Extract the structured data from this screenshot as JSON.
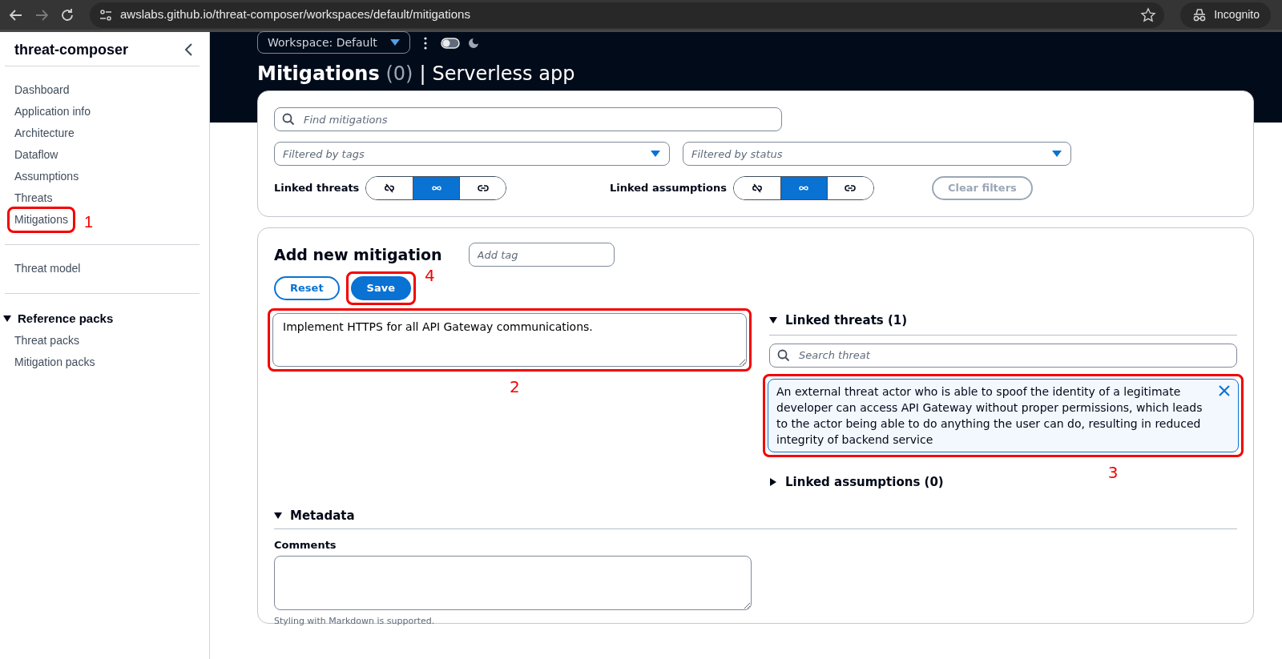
{
  "browser": {
    "url": "awslabs.github.io/threat-composer/workspaces/default/mitigations",
    "profile": "Incognito"
  },
  "sidebar": {
    "title": "threat-composer",
    "groups": [
      {
        "items": [
          {
            "label": "Dashboard"
          },
          {
            "label": "Application info"
          },
          {
            "label": "Architecture"
          },
          {
            "label": "Dataflow"
          },
          {
            "label": "Assumptions"
          },
          {
            "label": "Threats"
          },
          {
            "label": "Mitigations",
            "callout": "1"
          }
        ]
      },
      {
        "items": [
          {
            "label": "Threat model"
          }
        ]
      }
    ],
    "reference_packs": {
      "label": "Reference packs",
      "expanded": true,
      "items": [
        {
          "label": "Threat packs"
        },
        {
          "label": "Mitigation packs"
        }
      ]
    }
  },
  "header": {
    "workspace": "Workspace: Default",
    "dark_mode_on": false,
    "title": "Mitigations",
    "count": "(0)",
    "separator": "|",
    "subtitle": "Serverless app"
  },
  "filters": {
    "search_placeholder": "Find mitigations",
    "tags_placeholder": "Filtered by tags",
    "status_placeholder": "Filtered by status",
    "linked_threats": {
      "label": "Linked threats",
      "options": [
        {
          "kind": "unlinked",
          "selected": false
        },
        {
          "kind": "all",
          "selected": true
        },
        {
          "kind": "linked",
          "selected": false
        }
      ]
    },
    "linked_assumptions": {
      "label": "Linked assumptions",
      "options": [
        {
          "kind": "unlinked",
          "selected": false
        },
        {
          "kind": "all",
          "selected": true
        },
        {
          "kind": "linked",
          "selected": false
        }
      ]
    },
    "clear": {
      "label": "Clear filters",
      "disabled": true
    }
  },
  "editor": {
    "title": "Add new mitigation",
    "tag_placeholder": "Add tag",
    "buttons": [
      {
        "label": "Reset",
        "kind": "secondary"
      },
      {
        "label": "Save",
        "kind": "primary",
        "callout": "4"
      }
    ],
    "content": "Implement HTTPS for all API Gateway communications.",
    "content_callout": "2",
    "linked_threats": {
      "label": "Linked threats (1)",
      "expanded": true,
      "search_placeholder": "Search threat",
      "items": [
        {
          "text": "An external threat actor who is able to spoof the identity of a legitimate developer can access API Gateway without proper permissions, which leads to the actor being able to do anything the user can do, resulting in reduced integrity of backend service",
          "callout": "3"
        }
      ]
    },
    "linked_assumptions": {
      "label": "Linked assumptions (0)",
      "expanded": false
    },
    "metadata": {
      "label": "Metadata",
      "expanded": true,
      "comments_label": "Comments",
      "hint": "Styling with Markdown is supported."
    }
  }
}
